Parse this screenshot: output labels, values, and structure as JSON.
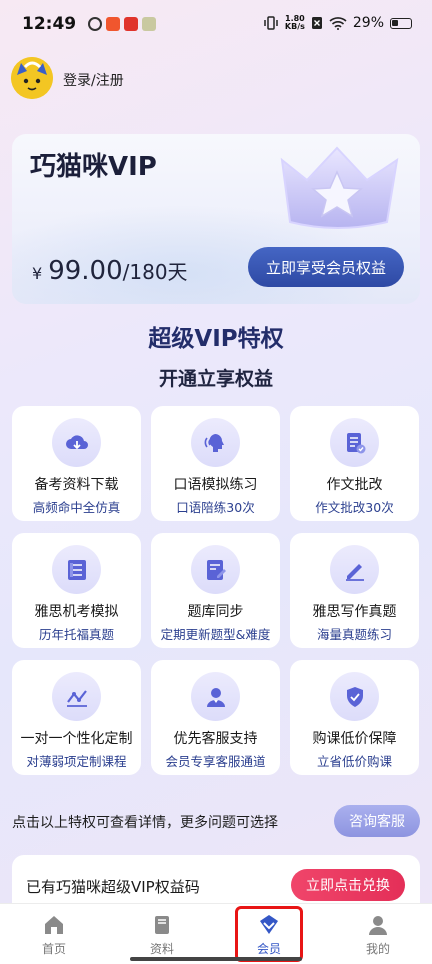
{
  "status_bar": {
    "time": "12:49",
    "speed_value": "1.80",
    "speed_unit": "KB/s",
    "battery": "29%"
  },
  "user": {
    "login_text": "登录/注册"
  },
  "vip_card": {
    "title": "巧猫咪VIP",
    "currency": "¥",
    "price": "99.00",
    "period": "/180天",
    "button": "立即享受会员权益"
  },
  "headline": {
    "title": "超级VIP特权",
    "subtitle": "开通立享权益"
  },
  "privileges": [
    {
      "title": "备考资料下载",
      "sub": "高频命中全仿真",
      "icon": "download-cloud-icon"
    },
    {
      "title": "口语模拟练习",
      "sub": "口语陪练30次",
      "icon": "speaking-head-icon"
    },
    {
      "title": "作文批改",
      "sub": "作文批改30次",
      "icon": "document-check-icon"
    },
    {
      "title": "雅思机考模拟",
      "sub": "历年托福真题",
      "icon": "exam-list-icon"
    },
    {
      "title": "题库同步",
      "sub": "定期更新题型&难度",
      "icon": "edit-document-icon"
    },
    {
      "title": "雅思写作真题",
      "sub": "海量真题练习",
      "icon": "pencil-icon"
    },
    {
      "title": "一对一个性化定制",
      "sub": "对薄弱项定制课程",
      "icon": "chart-line-icon"
    },
    {
      "title": "优先客服支持",
      "sub": "会员专享客服通道",
      "icon": "customer-service-icon"
    },
    {
      "title": "购课低价保障",
      "sub": "立省低价购课",
      "icon": "shield-check-icon"
    }
  ],
  "hint": {
    "text": "点击以上特权可查看详情，更多问题可选择",
    "button": "咨询客服"
  },
  "code_card": {
    "text": "已有巧猫咪超级VIP权益码",
    "button": "立即点击兑换"
  },
  "tabs": [
    {
      "label": "首页",
      "icon": "home-icon"
    },
    {
      "label": "资料",
      "icon": "book-icon"
    },
    {
      "label": "会员",
      "icon": "vip-diamond-icon",
      "active": true
    },
    {
      "label": "我的",
      "icon": "user-icon"
    }
  ],
  "colors": {
    "accent": "#3457c6",
    "redeem": "#e9375f",
    "highlight": "#e81515"
  }
}
